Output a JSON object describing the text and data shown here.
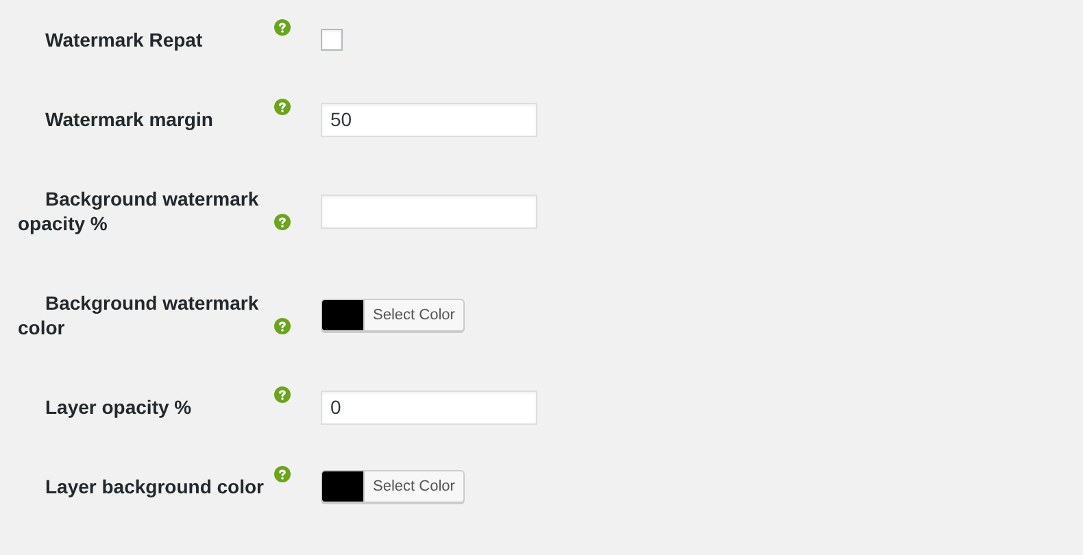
{
  "settings": [
    {
      "kind": "checkbox",
      "label": "Watermark Repat",
      "checked": false
    },
    {
      "kind": "text",
      "label": "Watermark margin",
      "value": "50"
    },
    {
      "kind": "text",
      "label": "Background watermark opacity %"
    },
    {
      "kind": "color",
      "label": "Background watermark color",
      "color": "#000000",
      "button": "Select Color"
    },
    {
      "kind": "text",
      "label": "Layer opacity %",
      "value": "0"
    },
    {
      "kind": "color",
      "label": "Layer background color",
      "color": "#000000",
      "button": "Select Color"
    }
  ]
}
